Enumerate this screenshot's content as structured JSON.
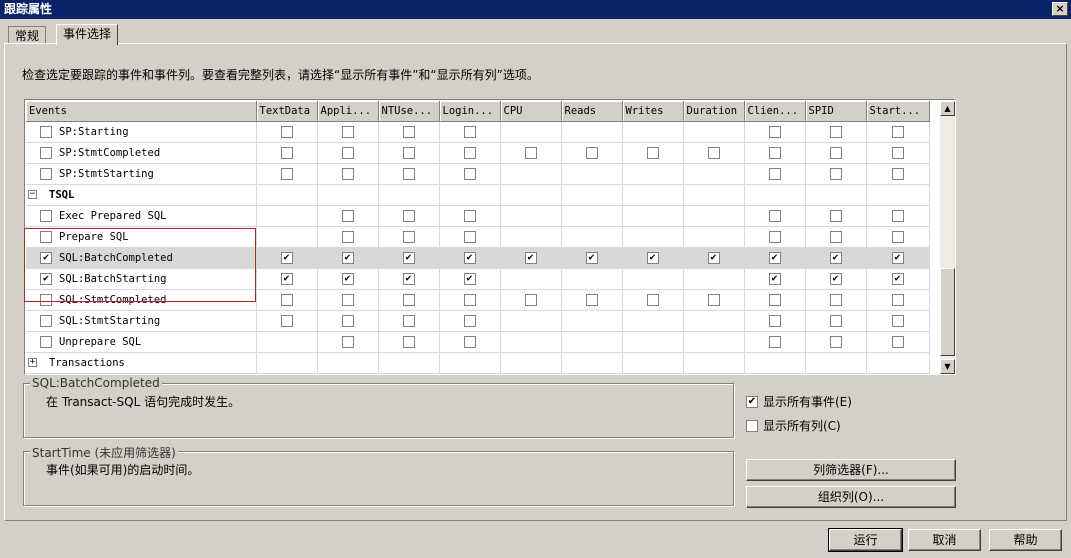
{
  "window": {
    "title": "跟踪属性",
    "close_label": "×"
  },
  "tabs": [
    {
      "label": "常规"
    },
    {
      "label": "事件选择"
    }
  ],
  "description": "检查选定要跟踪的事件和事件列。要查看完整列表，请选择“显示所有事件”和“显示所有列”选项。",
  "grid": {
    "columns": [
      "Events",
      "TextData",
      "Appli...",
      "NTUse...",
      "Login...",
      "CPU",
      "Reads",
      "Writes",
      "Duration",
      "Clien...",
      "SPID",
      "Start..."
    ],
    "rows": [
      {
        "type": "event",
        "label": "SP:Starting",
        "checked": false,
        "cells": [
          "u",
          "u",
          "u",
          "u",
          "",
          "",
          "",
          "",
          "u",
          "u",
          "u"
        ]
      },
      {
        "type": "event",
        "label": "SP:StmtCompleted",
        "checked": false,
        "cells": [
          "u",
          "u",
          "u",
          "u",
          "u",
          "u",
          "u",
          "u",
          "u",
          "u",
          "u"
        ]
      },
      {
        "type": "event",
        "label": "SP:StmtStarting",
        "checked": false,
        "cells": [
          "u",
          "u",
          "u",
          "u",
          "",
          "",
          "",
          "",
          "u",
          "u",
          "u"
        ]
      },
      {
        "type": "group",
        "label": "TSQL",
        "expander": "−",
        "cells": [
          "",
          "",
          "",
          "",
          "",
          "",
          "",
          "",
          "",
          "",
          ""
        ]
      },
      {
        "type": "event",
        "label": "Exec Prepared SQL",
        "checked": false,
        "cells": [
          "",
          "u",
          "u",
          "u",
          "",
          "",
          "",
          "",
          "u",
          "u",
          "u"
        ]
      },
      {
        "type": "event",
        "label": "Prepare SQL",
        "checked": false,
        "cells": [
          "",
          "u",
          "u",
          "u",
          "",
          "",
          "",
          "",
          "u",
          "u",
          "u"
        ]
      },
      {
        "type": "event",
        "label": "SQL:BatchCompleted",
        "checked": true,
        "selected": true,
        "cells": [
          "c",
          "c",
          "c",
          "c",
          "c",
          "c",
          "c",
          "c",
          "c",
          "c",
          "c"
        ]
      },
      {
        "type": "event",
        "label": "SQL:BatchStarting",
        "checked": true,
        "cells": [
          "c",
          "c",
          "c",
          "c",
          "",
          "",
          "",
          "",
          "c",
          "c",
          "c"
        ]
      },
      {
        "type": "event",
        "label": "SQL:StmtCompleted",
        "checked": false,
        "cells": [
          "u",
          "u",
          "u",
          "u",
          "u",
          "u",
          "u",
          "u",
          "u",
          "u",
          "u"
        ]
      },
      {
        "type": "event",
        "label": "SQL:StmtStarting",
        "checked": false,
        "cells": [
          "u",
          "u",
          "u",
          "u",
          "",
          "",
          "",
          "",
          "u",
          "u",
          "u"
        ]
      },
      {
        "type": "event",
        "label": "Unprepare SQL",
        "checked": false,
        "cells": [
          "",
          "u",
          "u",
          "u",
          "",
          "",
          "",
          "",
          "u",
          "u",
          "u"
        ]
      },
      {
        "type": "group",
        "label": "Transactions",
        "expander": "+",
        "normal": true,
        "cells": [
          "",
          "",
          "",
          "",
          "",
          "",
          "",
          "",
          "",
          "",
          ""
        ]
      }
    ]
  },
  "event_info": {
    "legend": "SQL:BatchCompleted",
    "text": "在 Transact-SQL 语句完成时发生。"
  },
  "column_info": {
    "legend": "StartTime (未应用筛选器)",
    "text": "事件(如果可用)的启动时间。"
  },
  "options": {
    "show_all_events": {
      "label": "显示所有事件(E)",
      "checked": true
    },
    "show_all_columns": {
      "label": "显示所有列(C)",
      "checked": false
    }
  },
  "buttons": {
    "column_filters": "列筛选器(F)...",
    "organize_columns": "组织列(O)...",
    "run": "运行",
    "cancel": "取消",
    "help": "帮助"
  },
  "scroll": {
    "up": "▲",
    "down": "▼"
  }
}
